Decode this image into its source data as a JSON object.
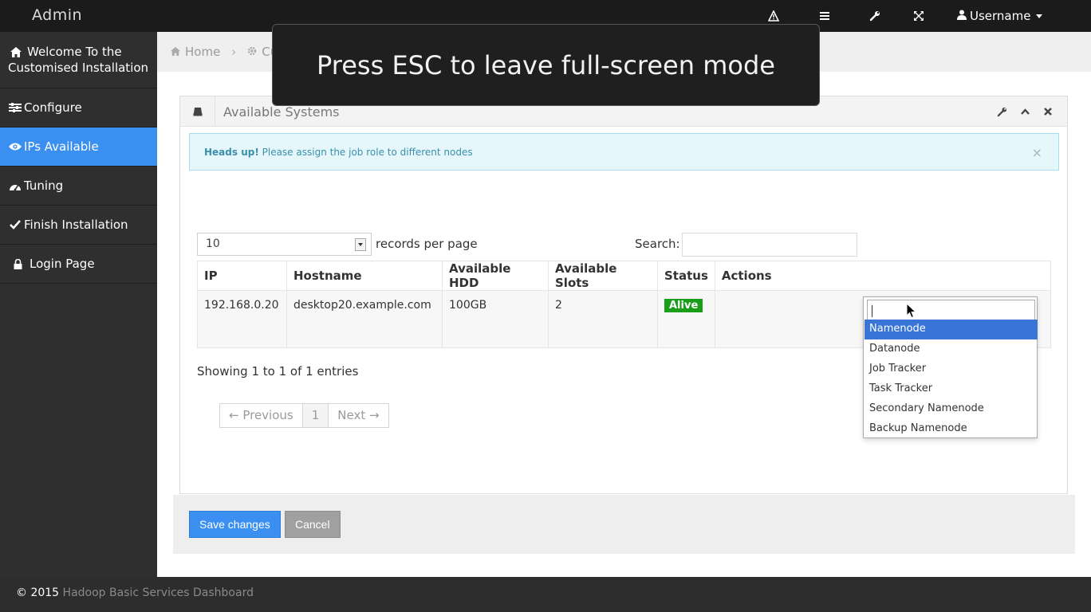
{
  "topbar": {
    "brand": "Admin",
    "icons": [
      "warning-icon",
      "list-icon",
      "wrench-icon",
      "fullscreen-icon"
    ],
    "user_label": "Username"
  },
  "sidebar": {
    "items": [
      {
        "label_line1": "Welcome To the",
        "label_line2": "Customised Installation",
        "icon": "home-icon"
      },
      {
        "label": "Configure",
        "icon": "sliders-icon"
      },
      {
        "label": "IPs Available",
        "icon": "eye-icon"
      },
      {
        "label": "Tuning",
        "icon": "dashboard-icon"
      },
      {
        "label": "Finish Installation",
        "icon": "check-icon"
      },
      {
        "label": "Login Page",
        "icon": "lock-icon"
      }
    ]
  },
  "breadcrumb": {
    "home": "Home",
    "current": "Cu"
  },
  "panel": {
    "title": "Available Systems",
    "alert_strong": "Heads up!",
    "alert_text": "Please assign the job role to different nodes",
    "alert_close": "×"
  },
  "table_controls": {
    "page_length": "10",
    "records_label": "records per page",
    "search_label": "Search:"
  },
  "table": {
    "headers": [
      "IP",
      "Hostname",
      "Available HDD",
      "Available Slots",
      "Status",
      "Actions"
    ],
    "rows": [
      {
        "ip": "192.168.0.20",
        "hostname": "desktop20.example.com",
        "hdd": "100GB",
        "slots": "2",
        "status": "Alive"
      }
    ]
  },
  "info": "Showing 1 to 1 of 1 entries",
  "pager": {
    "prev": "← Previous",
    "page": "1",
    "next": "Next →"
  },
  "buttons": {
    "save": "Save changes",
    "cancel": "Cancel"
  },
  "dropdown": {
    "options": [
      "Namenode",
      "Datanode",
      "Job Tracker",
      "Task Tracker",
      "Secondary Namenode",
      "Backup Namenode"
    ],
    "highlighted": "Namenode"
  },
  "fullscreen_notice": "Press ESC to leave full-screen mode",
  "footer": {
    "copyright": "© 2015",
    "link": "Hadoop Basic Services Dashboard"
  },
  "colors": {
    "accent": "#3a8ff0",
    "status_alive": "#1a9e1a",
    "navbar": "#1b1b1b",
    "sidebar": "#2f2f2f"
  }
}
